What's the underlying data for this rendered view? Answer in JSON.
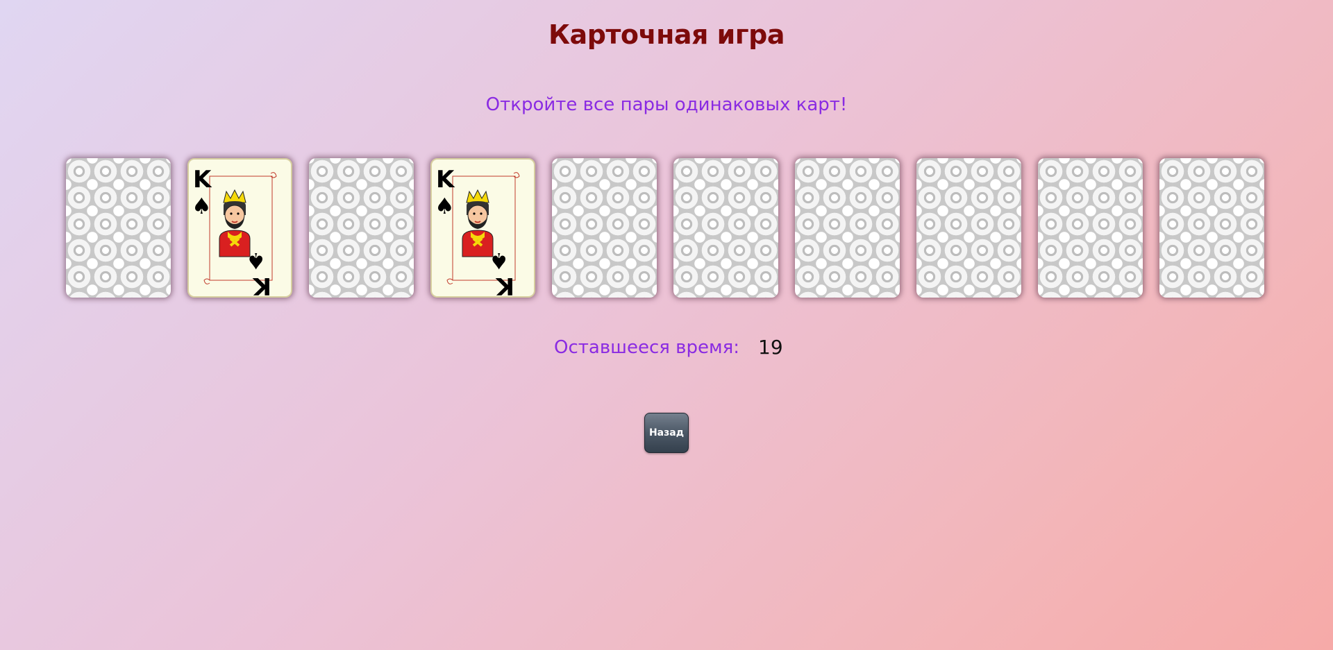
{
  "title": "Карточная игра",
  "subtitle": "Откройте все пары одинаковых карт!",
  "cards": [
    {
      "state": "face-down"
    },
    {
      "state": "face-up",
      "rank": "K",
      "suit": "spades",
      "suit_symbol": "♠"
    },
    {
      "state": "face-down"
    },
    {
      "state": "face-up",
      "rank": "K",
      "suit": "spades",
      "suit_symbol": "♠"
    },
    {
      "state": "face-down"
    },
    {
      "state": "face-down"
    },
    {
      "state": "face-down"
    },
    {
      "state": "face-down"
    },
    {
      "state": "face-down"
    },
    {
      "state": "face-down"
    }
  ],
  "timer": {
    "label": "Оставшееся время:",
    "value": "19"
  },
  "back_button": {
    "label": "Назад"
  },
  "colors": {
    "title": "#7d0a0a",
    "accent": "#8a2be2",
    "card_face": "#fbfbe6"
  }
}
